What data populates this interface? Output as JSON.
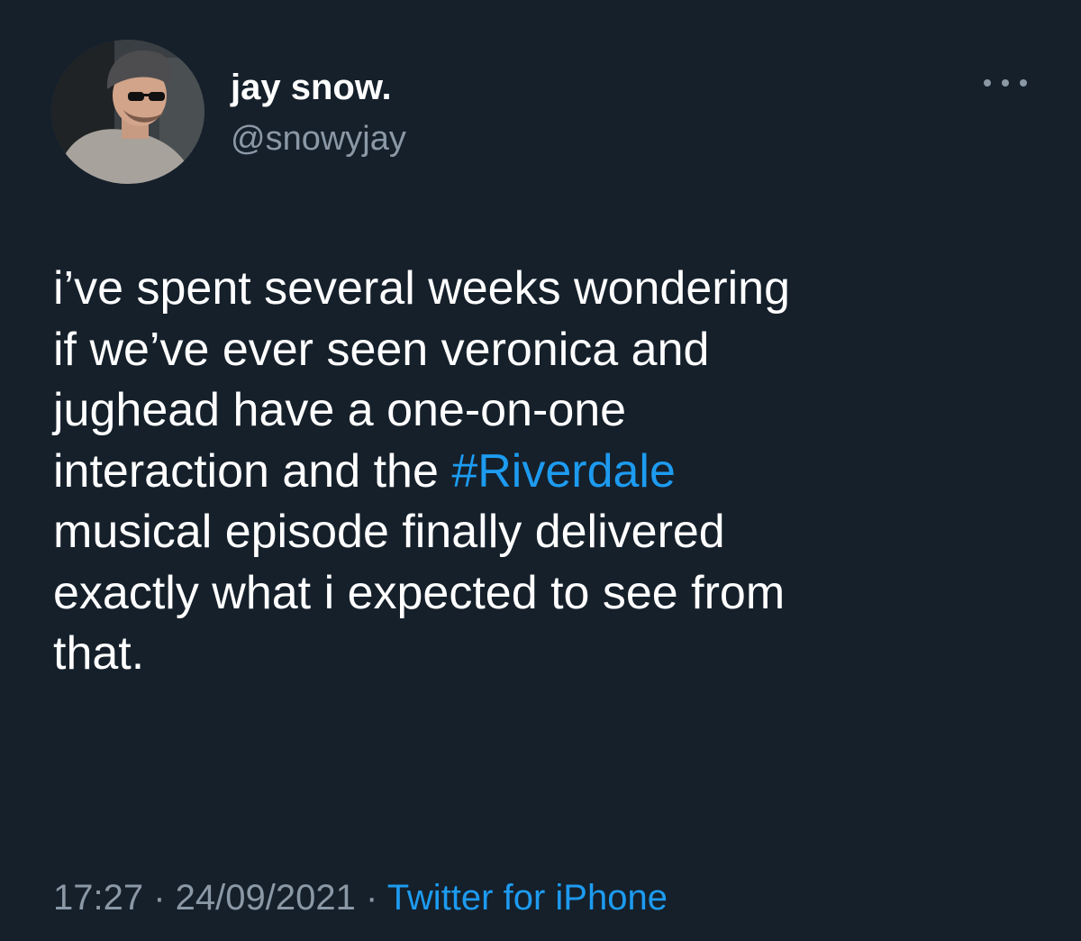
{
  "user": {
    "display_name": "jay snow.",
    "handle": "@snowyjay"
  },
  "menu": {
    "icon": "more-horizontal-icon"
  },
  "tweet": {
    "lines": [
      "i’ve spent several weeks wondering",
      "if we’ve ever seen veronica and",
      "jughead have a one-on-one",
      "interaction and the ",
      "musical episode finally delivered",
      "exactly what i expected to see from",
      "that."
    ],
    "hashtag": "#Riverdale"
  },
  "meta": {
    "time": "17:27",
    "separator1": " · ",
    "date": "24/09/2021",
    "separator2": " · ",
    "source": "Twitter for iPhone"
  },
  "colors": {
    "background": "#15202b",
    "text": "#ffffff",
    "secondary": "#8b98a5",
    "accent": "#1d9bf0"
  }
}
